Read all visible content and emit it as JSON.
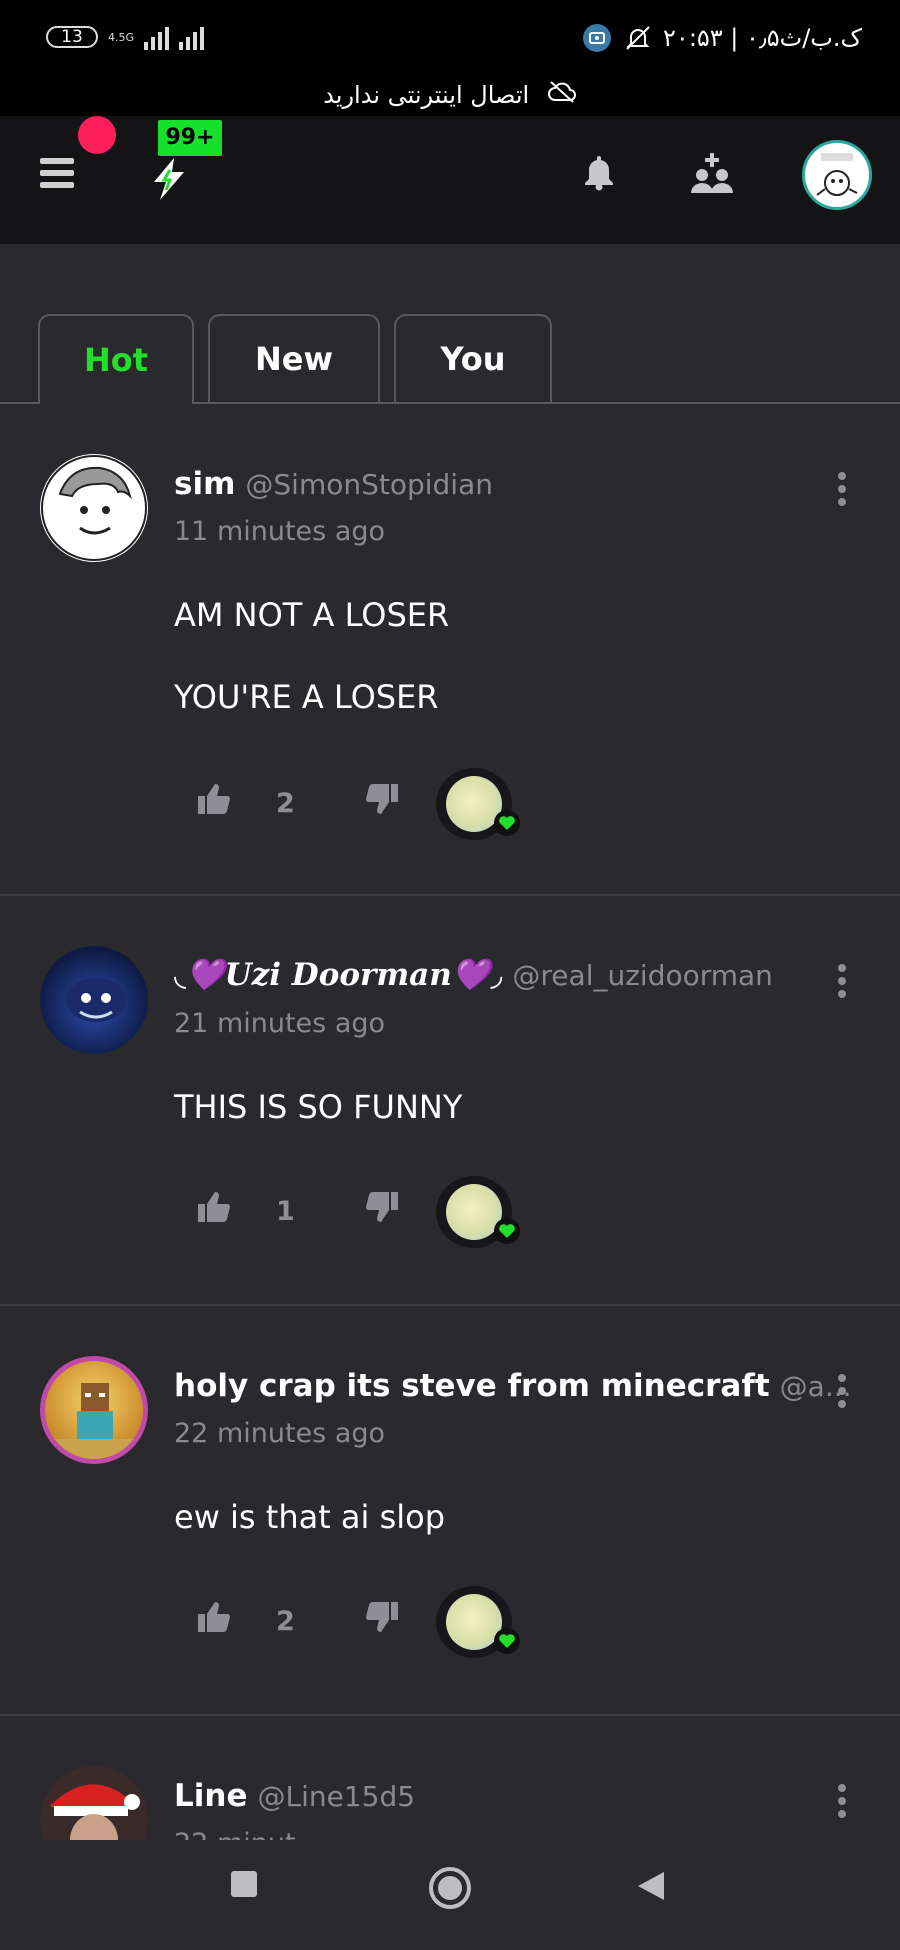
{
  "status_bar": {
    "battery": "13",
    "network": "4.5G",
    "right_text": "۲۰:۵۳ | ۰٫۵ک.ب/ث"
  },
  "offline_banner": "اتصال اینترنتی ندارید",
  "app_bar": {
    "notification_badge": "99+"
  },
  "tabs": [
    {
      "label": "Hot"
    },
    {
      "label": "New"
    },
    {
      "label": "You"
    }
  ],
  "posts": [
    {
      "name": "sim",
      "handle": "@SimonStopidian",
      "time": "11 minutes ago",
      "lines": [
        "AM NOT A LOSER",
        "YOU'RE A LOSER"
      ],
      "votes": "2"
    },
    {
      "name": "◟💜𝑼𝒛𝒊 𝑫𝒐𝒐𝒓𝒎𝒂𝒏💜◞",
      "handle": "@real_uzidoorman",
      "time": "21 minutes ago",
      "lines": [
        "THIS IS SO FUNNY"
      ],
      "votes": "1"
    },
    {
      "name": "holy crap its steve from minecraft",
      "handle": "@a...",
      "time": "22 minutes ago",
      "lines": [
        "ew is that ai slop"
      ],
      "votes": "2"
    },
    {
      "name": "Line",
      "handle": "@Line15d5",
      "time": "22 minut",
      "lines": [],
      "votes": ""
    }
  ],
  "colors": {
    "accent_green": "#22e02a",
    "background": "#2a292e",
    "red_dot": "#ff1f5a"
  }
}
